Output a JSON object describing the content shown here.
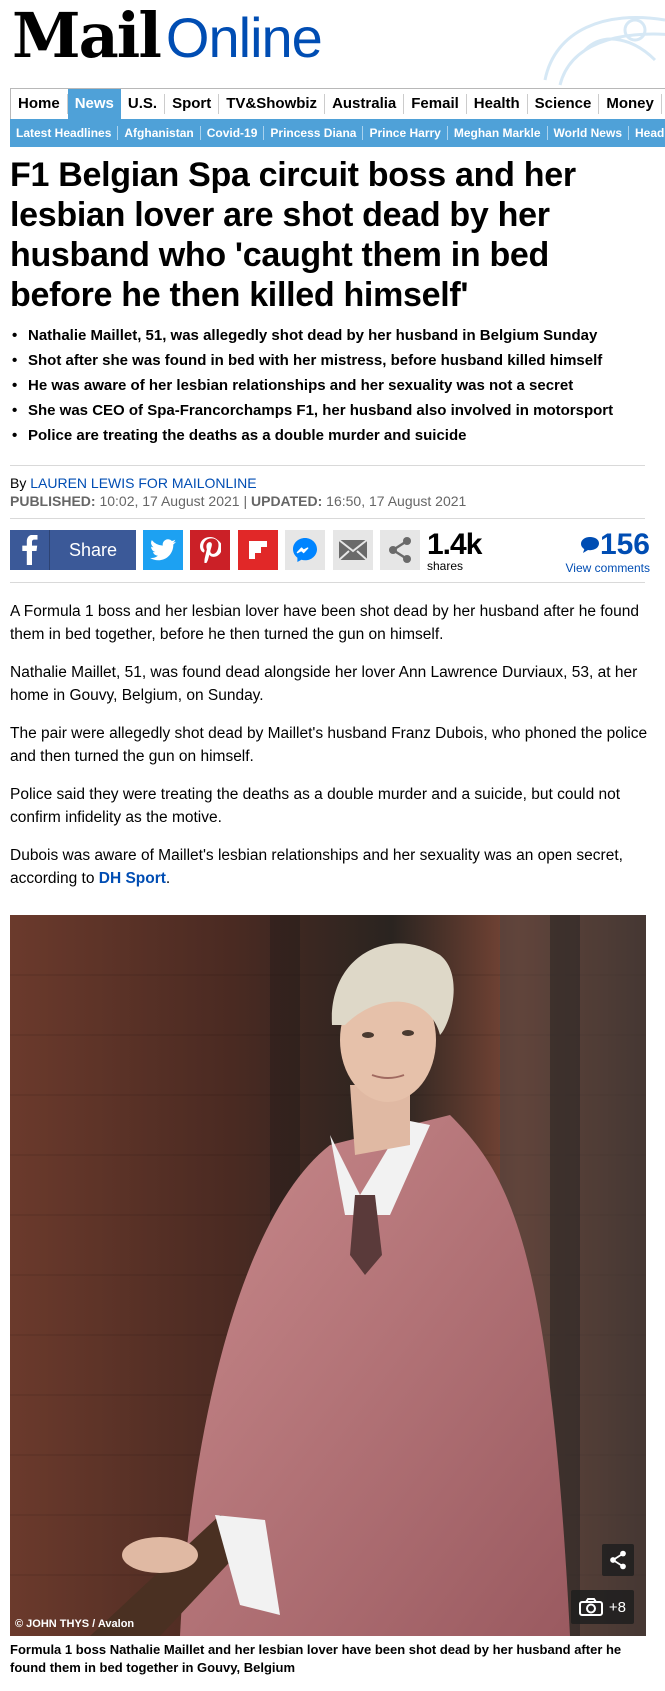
{
  "masthead": {
    "logo_mail": "Mail",
    "logo_online": "Online"
  },
  "nav": {
    "primary": [
      "Home",
      "News",
      "U.S.",
      "Sport",
      "TV&Showbiz",
      "Australia",
      "Femail",
      "Health",
      "Science",
      "Money",
      "V"
    ],
    "active": "News",
    "secondary": [
      "Latest Headlines",
      "Afghanistan",
      "Covid-19",
      "Princess Diana",
      "Prince Harry",
      "Meghan Markle",
      "World News",
      "Head"
    ]
  },
  "article": {
    "headline": "F1 Belgian Spa circuit boss and her lesbian lover are shot dead by her husband who 'caught them in bed before he then killed himself'",
    "bullets": [
      "Nathalie Maillet, 51, was allegedly shot dead by her husband in Belgium Sunday",
      "Shot after she was found in bed with her mistress, before husband killed himself",
      "He was aware of her lesbian relationships and her sexuality was not a secret",
      "She was CEO of Spa-Francorchamps F1, her husband also involved in motorsport",
      "Police are treating the deaths as a double murder and suicide"
    ],
    "byline_prefix": "By ",
    "author": "LAUREN LEWIS FOR MAILONLINE",
    "published_label": "PUBLISHED:",
    "published": " 10:02, 17 August 2021 | ",
    "updated_label": "UPDATED:",
    "updated": " 16:50, 17 August 2021",
    "paragraphs": [
      "A Formula 1 boss and her lesbian lover have been shot dead by her husband after he found them in bed together, before he then turned the gun on himself.",
      "Nathalie Maillet, 51, was found dead alongside her lover Ann Lawrence Durviaux, 53, at her home in Gouvy, Belgium, on Sunday.",
      "The pair were allegedly shot dead by Maillet's husband Franz Dubois, who phoned the police and then turned the gun on himself.",
      "Police said they were treating the deaths as a double murder and a suicide, but could not confirm infidelity as the motive."
    ],
    "last_paragraph_prefix": "Dubois was aware of Maillet's lesbian relationships and her sexuality was an open secret, according to ",
    "last_paragraph_link": "DH Sport",
    "last_paragraph_suffix": ".",
    "photo_credit": "© JOHN THYS / Avalon",
    "photo_count": "+8",
    "caption": "Formula 1 boss Nathalie Maillet and her lesbian lover have been shot dead by her husband after he found them in bed together in Gouvy, Belgium"
  },
  "share": {
    "share_label": "Share",
    "count": "1.4k",
    "count_label": "shares",
    "comments_count": "156",
    "comments_label": "View comments"
  },
  "icons": {
    "facebook": "facebook-icon",
    "twitter": "twitter-icon",
    "pinterest": "pinterest-icon",
    "flipboard": "flipboard-icon",
    "messenger": "messenger-icon",
    "email": "email-icon",
    "more": "share-more-icon",
    "comment": "comment-bubble-icon",
    "camera": "camera-icon"
  },
  "colors": {
    "brand_blue": "#004db3",
    "nav_blue": "#4fa1d8",
    "facebook": "#3b5998",
    "twitter": "#1da1f2",
    "pinterest": "#cb2027",
    "flipboard": "#e12828"
  }
}
